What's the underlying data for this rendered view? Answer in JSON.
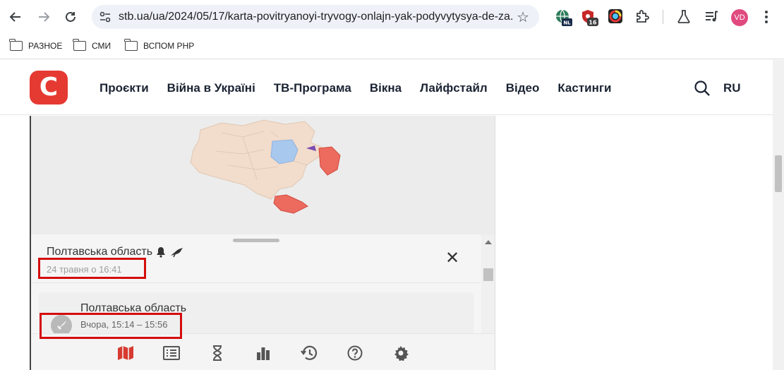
{
  "browser": {
    "url": "stb.ua/ua/2024/05/17/karta-povitryanoyi-tryvogy-onlajn-yak-podyvytysya-de-za...",
    "extension_badges": {
      "nl": "NL",
      "count": "16"
    },
    "profile_initials": "VD",
    "bookmarks": [
      "РАЗНОЕ",
      "СМИ",
      "ВСПОМ PHP"
    ]
  },
  "site": {
    "logo_letter": "С",
    "menu": [
      "Проєкти",
      "Війна в Україні",
      "ТВ-Програма",
      "Вікна",
      "Лайфстайл",
      "Відео",
      "Кастинги"
    ],
    "lang": "RU",
    "accent": "#e53a32"
  },
  "alert_app": {
    "current": {
      "region": "Полтавська область",
      "time": "24 травня о 16:41"
    },
    "history": [
      {
        "region": "Полтавська область",
        "time": "Вчора, 15:14 – 15:56"
      }
    ],
    "toolbar": [
      "map-icon",
      "list-icon",
      "hourglass-icon",
      "bar-chart-icon",
      "history-icon",
      "help-icon",
      "settings-icon"
    ],
    "active_color": "#d73a31"
  }
}
